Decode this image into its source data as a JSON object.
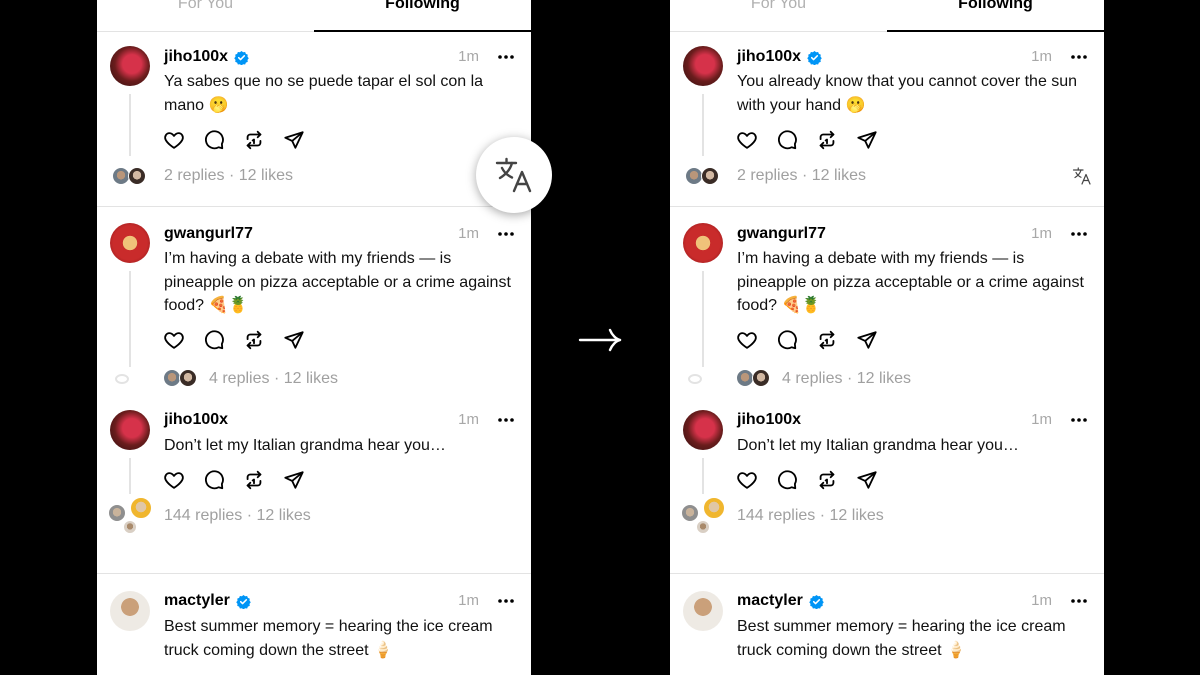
{
  "tabs": {
    "for_you": "For You",
    "following": "Following"
  },
  "panels": [
    {
      "posts": [
        {
          "username": "jiho100x",
          "verified": true,
          "time": "1m",
          "text": "Ya sabes que no se puede tapar el sol con la mano 🫢",
          "replies": "2 replies",
          "likes": "12 likes"
        },
        {
          "username": "gwangurl77",
          "verified": false,
          "time": "1m",
          "text": "I’m having a debate with my friends — is pineapple on pizza acceptable or a crime against food? 🍕🍍",
          "replies": "4 replies",
          "likes": "12 likes"
        },
        {
          "username": "jiho100x",
          "verified": false,
          "time": "1m",
          "text": "Don’t let my Italian grandma hear you…",
          "replies": "144 replies",
          "likes": "12 likes"
        },
        {
          "username": "mactyler",
          "verified": true,
          "time": "1m",
          "text": "Best summer memory = hearing the ice cream truck coming down the street 🍦"
        }
      ]
    },
    {
      "posts": [
        {
          "username": "jiho100x",
          "verified": true,
          "time": "1m",
          "text": "You already know that you cannot cover the sun with your hand 🫢",
          "replies": "2 replies",
          "likes": "12 likes"
        },
        {
          "username": "gwangurl77",
          "verified": false,
          "time": "1m",
          "text": "I’m having a debate with my friends — is pineapple on pizza acceptable or a crime against food? 🍕🍍",
          "replies": "4 replies",
          "likes": "12 likes"
        },
        {
          "username": "jiho100x",
          "verified": false,
          "time": "1m",
          "text": "Don’t let my Italian grandma hear you…",
          "replies": "144 replies",
          "likes": "12 likes"
        },
        {
          "username": "mactyler",
          "verified": true,
          "time": "1m",
          "text": "Best summer memory = hearing the ice cream truck coming down the street 🍦"
        }
      ]
    }
  ],
  "meta_separator": "·",
  "icons": [
    "heart-icon",
    "comment-icon",
    "repost-icon",
    "share-icon",
    "translate-icon",
    "verified-badge-icon",
    "more-icon",
    "arrow-right-icon"
  ],
  "colors": {
    "verified": "#0095f6",
    "muted": "#a0a0a0",
    "divider": "#e3e3e3"
  }
}
